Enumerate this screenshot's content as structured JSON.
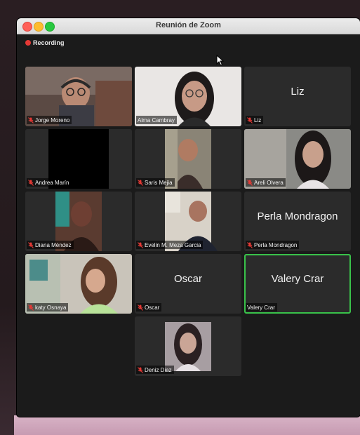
{
  "window": {
    "title": "Reunión de Zoom"
  },
  "status": {
    "recording_label": "Recording"
  },
  "participants": [
    {
      "name": "Jorge Moreno"
    },
    {
      "name": "Alma Cambray"
    },
    {
      "name": "Liz"
    },
    {
      "name": "Andrea Marín"
    },
    {
      "name": "Saris Mejia"
    },
    {
      "name": "Areli Olvera"
    },
    {
      "name": "Diana Méndez"
    },
    {
      "name": "Evelin M. Meza Garcia"
    },
    {
      "name": "Perla Mondragon"
    },
    {
      "name": "katy Osnaya"
    },
    {
      "name": "Oscar"
    },
    {
      "name": "Valery Crar"
    },
    {
      "name": "Deniz Diaz"
    }
  ],
  "colors": {
    "active_speaker": "#39c24a",
    "recording": "#e53935",
    "muted": "#e53935"
  },
  "icons": {
    "mute": "mic-muted-icon",
    "cursor": "cursor-icon"
  }
}
